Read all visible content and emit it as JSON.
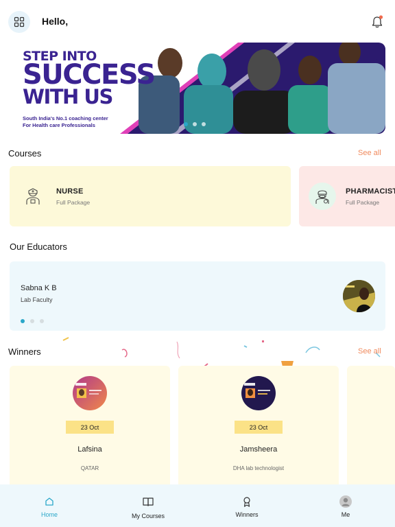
{
  "header": {
    "greeting": "Hello,",
    "menu_icon": "grid-icon",
    "notification_icon": "bell-icon"
  },
  "banner": {
    "headline_line1": "STEP INTO",
    "headline_line2": "SUCCESS",
    "headline_line3": "WITH US",
    "subtitle_line1": "South India's No.1 coaching center",
    "subtitle_line2": "For Health care Professionals",
    "active_slide": 1,
    "slide_count": 3
  },
  "courses": {
    "title": "Courses",
    "see_all": "See all",
    "items": [
      {
        "name": "NURSE",
        "subtitle": "Full Package",
        "icon": "nurse-icon",
        "color": "#fdf9d9"
      },
      {
        "name": "PHARMACIST",
        "subtitle": "Full Package",
        "icon": "pharmacist-icon",
        "color": "#fde8e6"
      }
    ]
  },
  "educators": {
    "title": "Our Educators",
    "items": [
      {
        "name": "Sabna K B",
        "role": "Lab Faculty"
      }
    ],
    "active_dot": 1,
    "dot_count": 3
  },
  "winners": {
    "title": "Winners",
    "see_all": "See all",
    "items": [
      {
        "date": "23 Oct",
        "name": "Lafsina",
        "place": "QATAR"
      },
      {
        "date": "23 Oct",
        "name": "Jamsheera",
        "place": "DHA lab technologist"
      }
    ]
  },
  "bottom_nav": {
    "items": [
      {
        "label": "Home",
        "icon": "home-icon",
        "active": true
      },
      {
        "label": "My Courses",
        "icon": "book-icon",
        "active": false
      },
      {
        "label": "Winners",
        "icon": "award-icon",
        "active": false
      },
      {
        "label": "Me",
        "icon": "user-avatar-icon",
        "active": false
      }
    ]
  },
  "colors": {
    "accent": "#2aa7c9",
    "see_all": "#f08a5d",
    "banner_purple": "#3a2391",
    "course_nurse": "#fdf9d9",
    "course_pharmacist": "#fde8e6",
    "educator_bg": "#eef8fc",
    "winner_bg": "#fffbe6",
    "date_badge": "#fbe287"
  }
}
